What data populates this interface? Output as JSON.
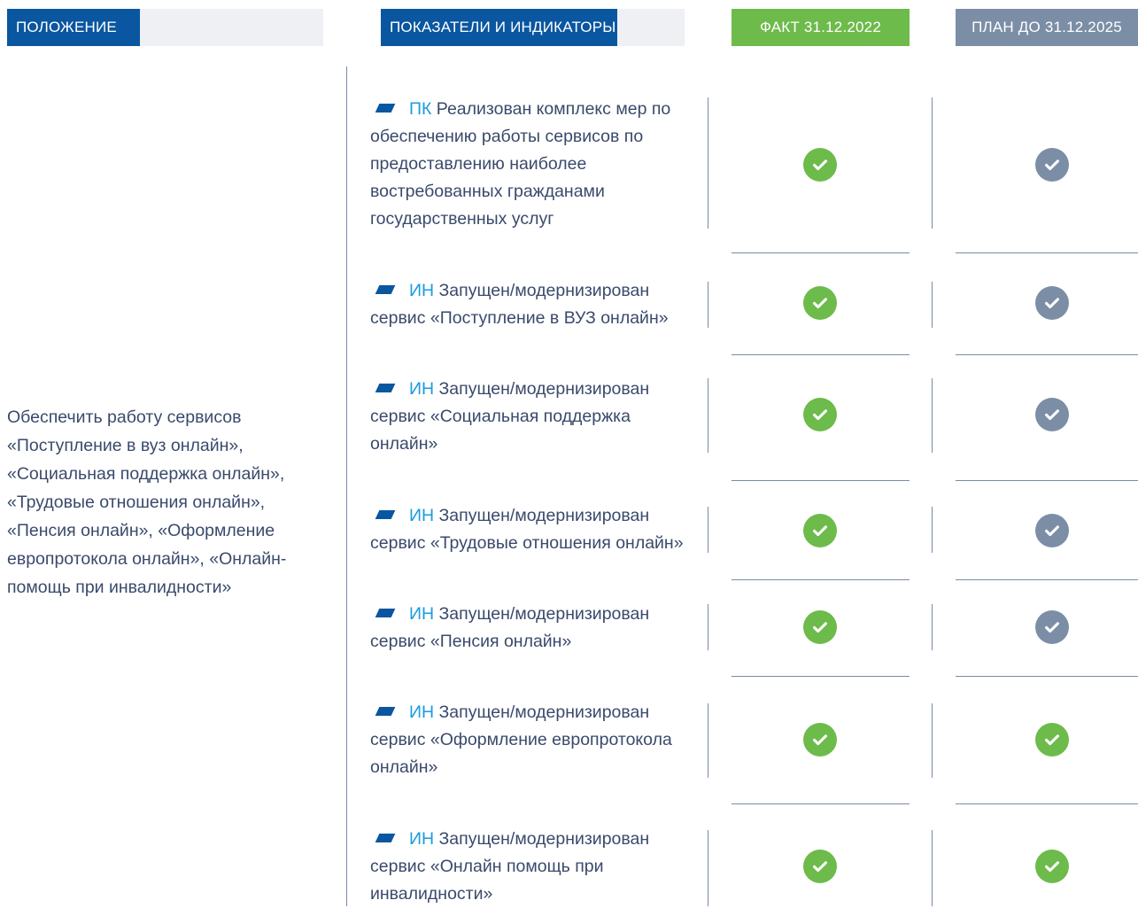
{
  "header": {
    "position": "ПОЛОЖЕНИЕ",
    "indicators": "ПОКАЗАТЕЛИ И ИНДИКАТОРЫ",
    "fact": "ФАКТ 31.12.2022",
    "plan": "ПЛАН ДО 31.12.2025"
  },
  "colors": {
    "header_blue": "#0a56a0",
    "fact_green": "#6dbb4a",
    "plan_gray": "#7c8ea6",
    "code_accent": "#1a9be0",
    "text": "#3a4a6b"
  },
  "position_text": "Обеспечить работу сервисов «Поступление в вуз онлайн», «Социальная поддержка онлайн», «Трудовые отношения онлайн», «Пенсия онлайн», «Оформление европротокола онлайн», «Онлайн-помощь при инвалидности»",
  "rows": [
    {
      "code": "ПК",
      "text": "Реализован комплекс мер по обеспечению работы сервисов по предоставлению наиболее востребованных гражданами государственных услуг",
      "fact": "achieved",
      "plan": "planned"
    },
    {
      "code": "ИН",
      "text": "Запущен/модернизирован сервис «Поступление в ВУЗ онлайн»",
      "fact": "achieved",
      "plan": "planned"
    },
    {
      "code": "ИН",
      "text": "Запущен/модернизирован сервис «Социальная поддержка онлайн»",
      "fact": "achieved",
      "plan": "planned"
    },
    {
      "code": "ИН",
      "text": "Запущен/модернизирован сервис «Трудовые отношения онлайн»",
      "fact": "achieved",
      "plan": "planned"
    },
    {
      "code": "ИН",
      "text": "Запущен/модернизирован сервис «Пенсия онлайн»",
      "fact": "achieved",
      "plan": "planned"
    },
    {
      "code": "ИН",
      "text": "Запущен/модернизирован сервис «Оформление европротокола онлайн»",
      "fact": "achieved",
      "plan": "achieved"
    },
    {
      "code": "ИН",
      "text": "Запущен/модернизирован сервис «Онлайн помощь при инвалидности»",
      "fact": "achieved",
      "plan": "achieved"
    }
  ],
  "icons": {
    "status": "check-circle-icon",
    "marker": "parallelogram-marker-icon"
  }
}
